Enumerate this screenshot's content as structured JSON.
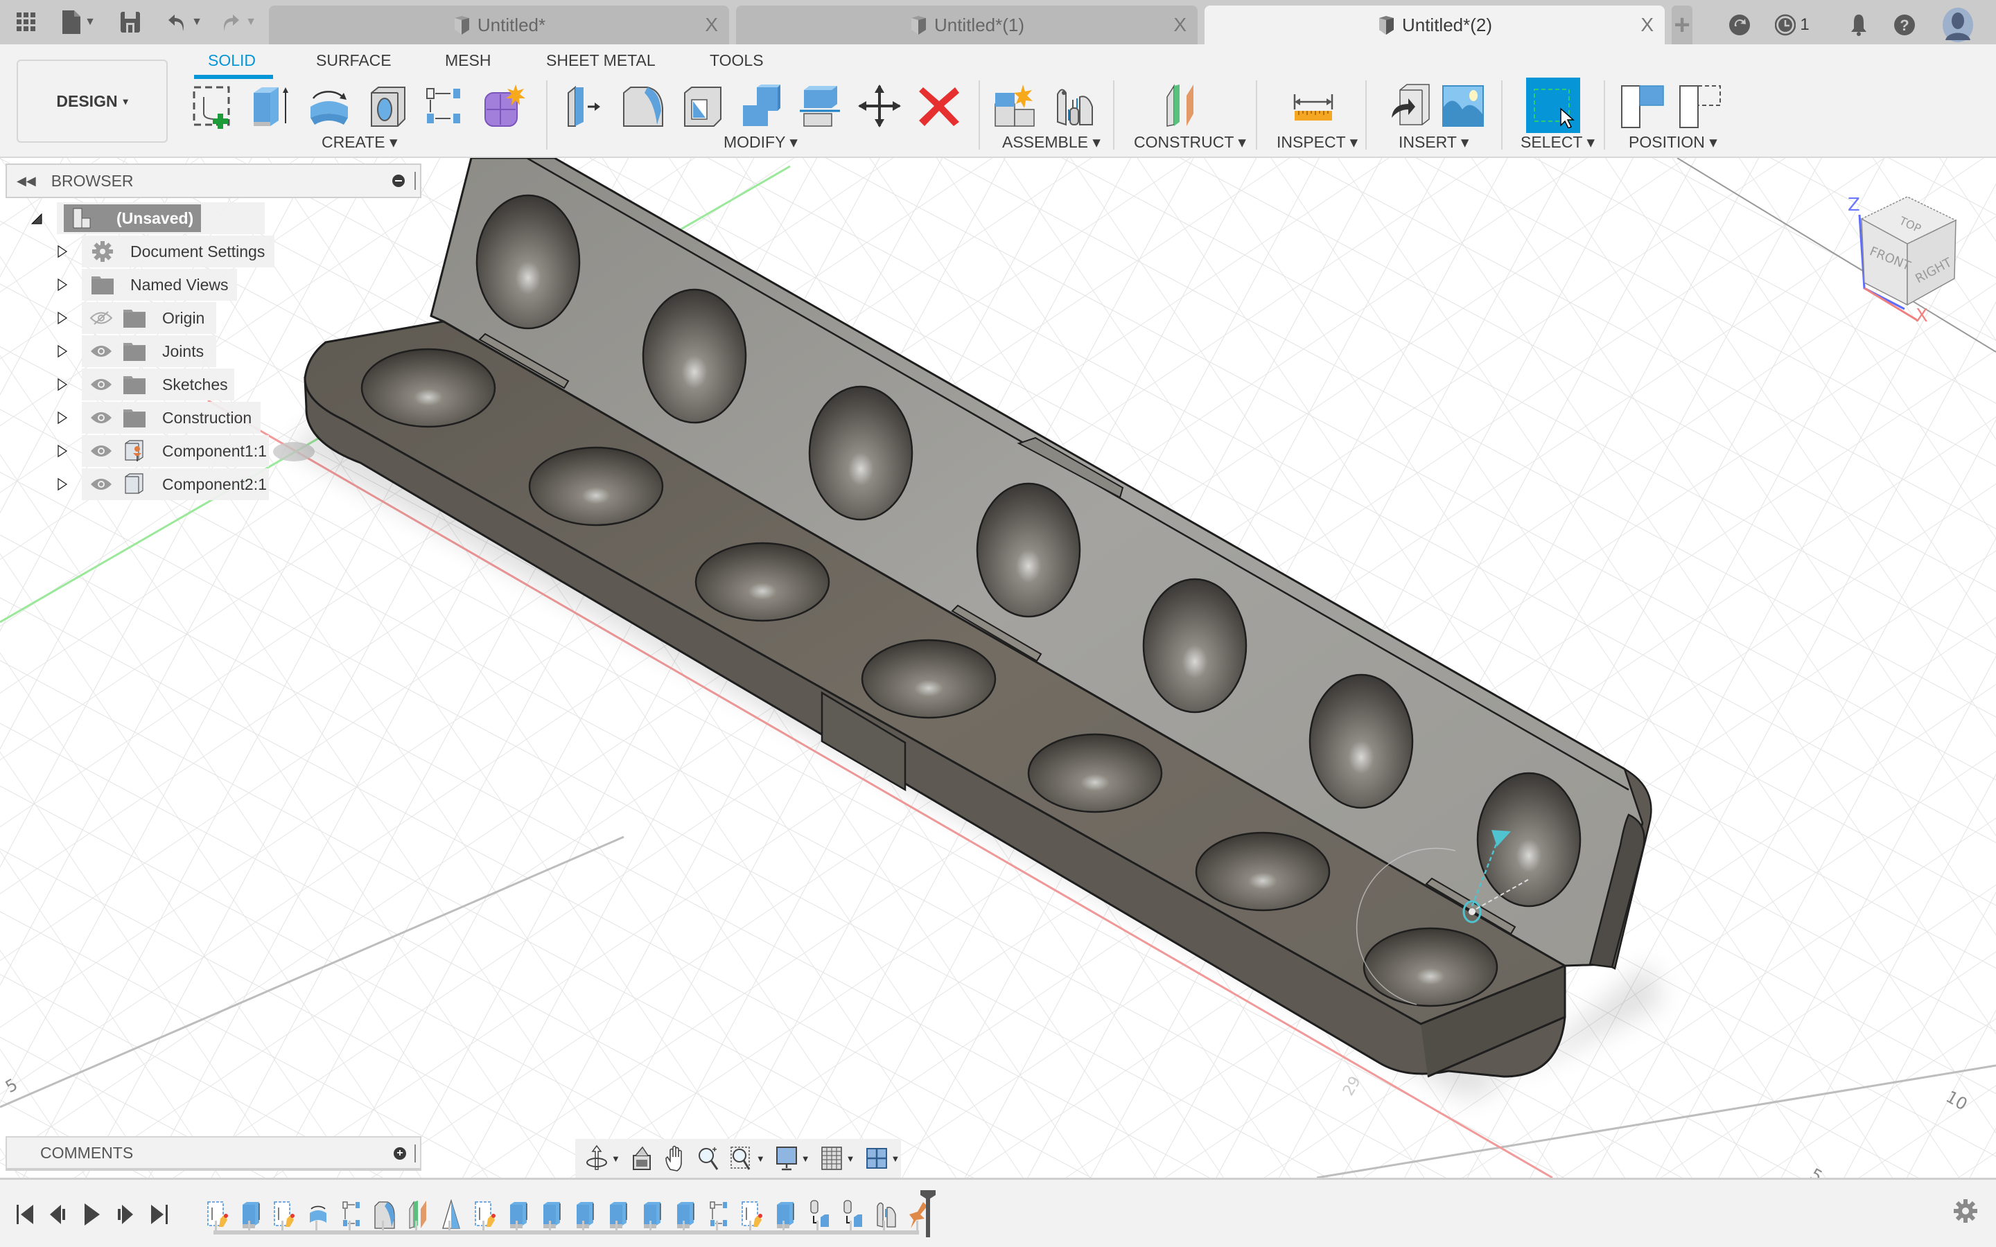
{
  "titlebar": {
    "tabs": [
      {
        "label": "Untitled*",
        "active": false
      },
      {
        "label": "Untitled*(1)",
        "active": false
      },
      {
        "label": "Untitled*(2)",
        "active": true
      }
    ],
    "close_glyph": "X",
    "new_tab_glyph": "+",
    "jobs_count": "1",
    "icons": [
      "app-grid-icon",
      "file-icon",
      "save-icon",
      "undo-icon",
      "redo-icon",
      "new-tab-icon",
      "offline-sync-icon",
      "job-status-icon",
      "notifications-bell-icon",
      "help-icon",
      "user-avatar-icon"
    ]
  },
  "toolbar": {
    "workspace": "DESIGN",
    "workspace_caret": "▾",
    "tabs": [
      "SOLID",
      "SURFACE",
      "MESH",
      "SHEET METAL",
      "TOOLS"
    ],
    "active_tab": "SOLID",
    "groups": [
      {
        "label": "CREATE ▾",
        "tools": [
          "create-sketch",
          "extrude",
          "revolve",
          "hole",
          "rectangular-pattern",
          "create-form"
        ]
      },
      {
        "label": "MODIFY ▾",
        "tools": [
          "press-pull",
          "fillet",
          "shell",
          "combine",
          "offset-face",
          "move-copy",
          "delete"
        ]
      },
      {
        "label": "ASSEMBLE ▾",
        "tools": [
          "new-component",
          "joint"
        ]
      },
      {
        "label": "CONSTRUCT ▾",
        "tools": [
          "offset-plane"
        ]
      },
      {
        "label": "INSPECT ▾",
        "tools": [
          "measure"
        ]
      },
      {
        "label": "INSERT ▾",
        "tools": [
          "insert-derive",
          "insert-canvas"
        ]
      },
      {
        "label": "SELECT ▾",
        "tools": [
          "select"
        ]
      },
      {
        "label": "POSITION ▾",
        "tools": [
          "capture-position",
          "revert-position"
        ]
      }
    ],
    "accent_color": "#0696d7"
  },
  "browser": {
    "title": "BROWSER",
    "root": {
      "label": "(Unsaved)"
    },
    "items": [
      {
        "label": "Document Settings",
        "icon": "gear",
        "eye": "none"
      },
      {
        "label": "Named Views",
        "icon": "folder",
        "eye": "none"
      },
      {
        "label": "Origin",
        "icon": "folder",
        "eye": "hidden"
      },
      {
        "label": "Joints",
        "icon": "folder",
        "eye": "visible"
      },
      {
        "label": "Sketches",
        "icon": "folder",
        "eye": "visible"
      },
      {
        "label": "Construction",
        "icon": "folder",
        "eye": "visible"
      },
      {
        "label": "Component1:1",
        "icon": "grounded-component",
        "eye": "visible"
      },
      {
        "label": "Component2:1",
        "icon": "component",
        "eye": "visible"
      }
    ]
  },
  "comments": {
    "title": "COMMENTS"
  },
  "viewcube": {
    "faces": [
      "TOP",
      "FRONT",
      "RIGHT"
    ],
    "axes": [
      "Z",
      "X"
    ]
  },
  "viewport": {
    "grid_labels": [
      "5",
      "10",
      "5"
    ],
    "joint_angle_label": "29",
    "model_colors": {
      "base": "#6f6a62",
      "lid": "#9d9c97",
      "edge": "#1e1e1e",
      "joint": "#4fc3cf"
    },
    "axis_colors": {
      "x": "#f08080",
      "y": "#7be07b",
      "z": "#5b6cff"
    }
  },
  "navbar": {
    "tools": [
      "orbit",
      "look-at",
      "pan",
      "zoom",
      "fit",
      "display-settings",
      "grid-settings",
      "viewports"
    ]
  },
  "timeline": {
    "controls": [
      "go-to-start",
      "previous-step",
      "play",
      "next-step",
      "go-to-end"
    ],
    "features": [
      "sketch",
      "extrude",
      "sketch",
      "revolve",
      "pattern",
      "fillet",
      "offset-plane",
      "draft",
      "sketch",
      "extrude",
      "extrude",
      "extrude",
      "extrude",
      "extrude",
      "extrude",
      "pattern",
      "sketch",
      "extrude",
      "rigid-group",
      "rigid-group",
      "joint",
      "ground"
    ]
  }
}
